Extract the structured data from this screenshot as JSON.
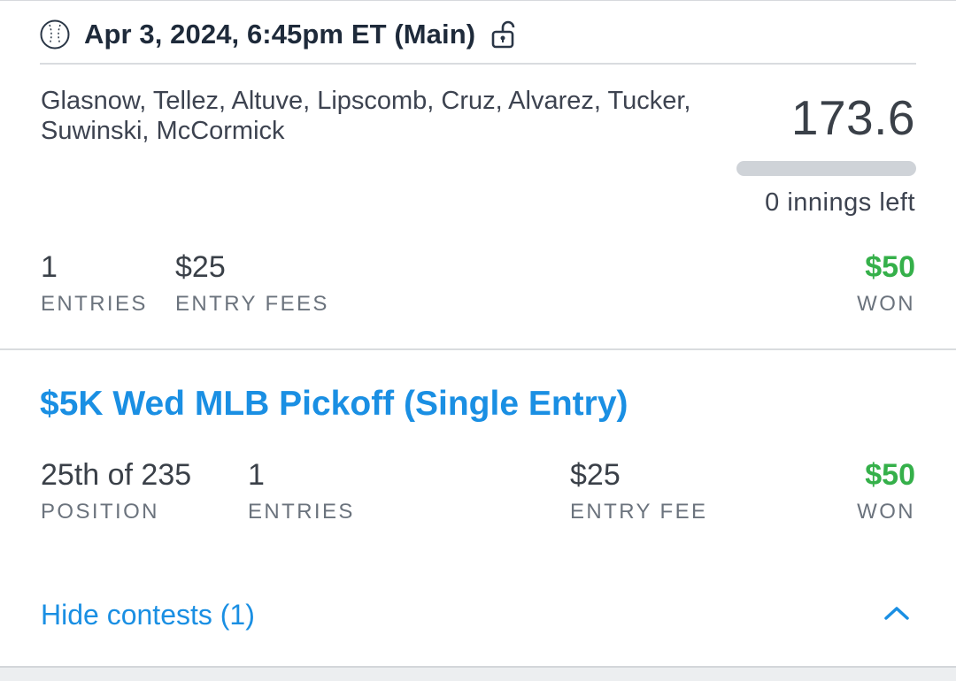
{
  "header": {
    "title": "Apr 3, 2024, 6:45pm ET (Main)",
    "sport_icon": "baseball-icon",
    "lock_icon": "unlock-icon"
  },
  "lineup": {
    "players": "Glasnow, Tellez, Altuve, Lipscomb, Cruz, Alvarez, Tucker, Suwinski, McCormick",
    "score": "173.6",
    "progress_fraction": 1.0,
    "innings_left": "0 innings left"
  },
  "summary": {
    "entries_value": "1",
    "entries_label": "ENTRIES",
    "fees_value": "$25",
    "fees_label": "ENTRY FEES",
    "won_value": "$50",
    "won_label": "WON"
  },
  "contest": {
    "title": "$5K Wed MLB Pickoff (Single Entry)",
    "position_value": "25th of 235",
    "position_label": "POSITION",
    "entries_value": "1",
    "entries_label": "ENTRIES",
    "fee_value": "$25",
    "fee_label": "ENTRY FEE",
    "won_value": "$50",
    "won_label": "WON"
  },
  "footer": {
    "hide_label": "Hide contests (1)",
    "chevron_icon": "chevron-up-icon"
  },
  "colors": {
    "accent_blue": "#1a8fe3",
    "won_green": "#35b04a",
    "title_dark": "#1e2a3a",
    "progress_gray": "#cfd3d8"
  }
}
